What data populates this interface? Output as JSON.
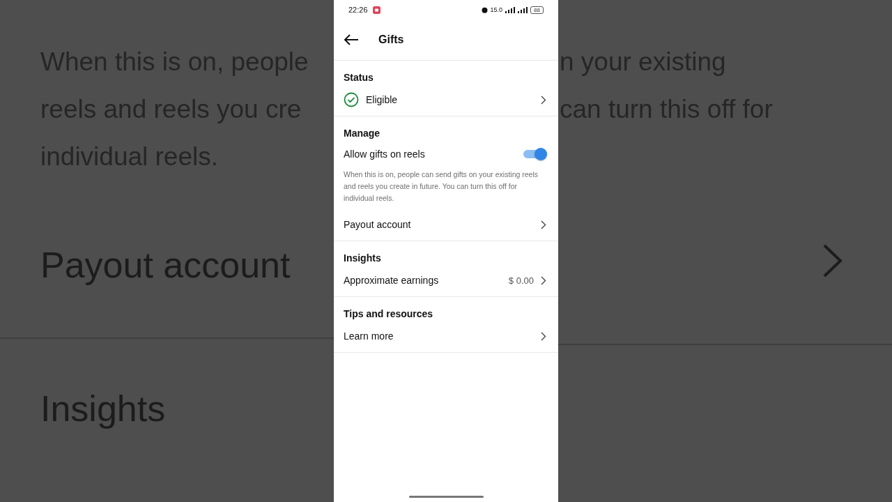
{
  "background": {
    "left_lines": [
      "When this is on, people",
      "reels and reels you cre",
      "individual reels."
    ],
    "right_lines": [
      "n your existing",
      "can turn this off for"
    ],
    "left_row": "Payout account",
    "left_section": "Insights"
  },
  "status_bar": {
    "time": "22:26",
    "speed": "15.0",
    "battery": "88"
  },
  "header": {
    "title": "Gifts"
  },
  "sections": [
    {
      "title": "Status",
      "rows": [
        {
          "kind": "status",
          "label": "Eligible"
        }
      ]
    },
    {
      "title": "Manage",
      "rows": [
        {
          "kind": "toggle",
          "label": "Allow gifts on reels",
          "on": true,
          "description": "When this is on, people can send gifts on your existing reels and reels you create in future. You can turn this off for individual reels."
        },
        {
          "kind": "link",
          "label": "Payout account"
        }
      ]
    },
    {
      "title": "Insights",
      "rows": [
        {
          "kind": "link",
          "label": "Approximate earnings",
          "value": "$ 0.00"
        }
      ]
    },
    {
      "title": "Tips and resources",
      "rows": [
        {
          "kind": "link",
          "label": "Learn more"
        }
      ]
    }
  ]
}
